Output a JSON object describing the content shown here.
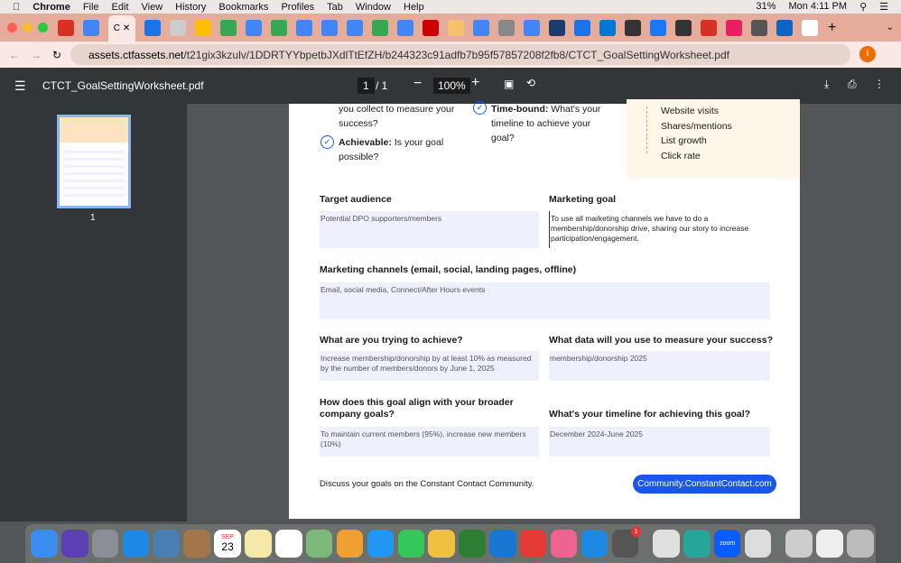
{
  "menubar": {
    "app": "Chrome",
    "items": [
      "File",
      "Edit",
      "View",
      "History",
      "Bookmarks",
      "Profiles",
      "Tab",
      "Window",
      "Help"
    ],
    "battery": "31%",
    "clock": "Mon 4:11 PM"
  },
  "tabs": {
    "active_label": "C",
    "colors": [
      "#d93025",
      "#4285f4",
      "#1a73e8",
      "#cccccc",
      "#fbbc04",
      "#34a853",
      "#4285f4",
      "#34a853",
      "#4285f4",
      "#4285f4",
      "#4285f4",
      "#34a853",
      "#4285f4",
      "#cc0000",
      "#f5c16c",
      "#4285f4",
      "#888888",
      "#4285f4",
      "#1d3c6e",
      "#1a73e8",
      "#0078d4",
      "#333333",
      "#1877f2",
      "#333333",
      "#d93025",
      "#e91e63",
      "#555555",
      "#0a66c2",
      "#ffffff"
    ]
  },
  "address": {
    "host": "assets.ctfassets.net",
    "path": "/t21gix3kzulv/1DDRTYYbpetbJXdlTtEfZH/b244323c91adfb7b95f57857208f2fb8/CTCT_GoalSettingWorksheet.pdf",
    "avatar": "I"
  },
  "pdf": {
    "title": "CTCT_GoalSettingWorksheet.pdf",
    "page_current": "1",
    "page_total": "/ 1",
    "zoom": "100%",
    "thumb_page": "1"
  },
  "doc": {
    "smart": [
      {
        "text": "you collect to measure your success?"
      },
      {
        "bold": "Achievable:",
        "text": " Is your goal possible?"
      },
      {
        "bold": "Time-bound:",
        "text": " What's your timeline to achieve your goal?"
      }
    ],
    "metrics": [
      "Website visits",
      "Shares/mentions",
      "List growth",
      "Click rate"
    ],
    "fields": [
      {
        "label": "Target audience",
        "value": "Potential DPO supporters/members"
      },
      {
        "label": "Marketing goal",
        "value": "To use all marketing channels we have to do a membership/donorship drive, sharing our story to increase participation/engagement."
      },
      {
        "label": "Marketing channels (email, social, landing pages, offline)",
        "value": "Email, social media, Connect/After Hours events"
      },
      {
        "label": "What are you trying to achieve?",
        "value": "Increase membership/donorship by at least 10% as measured by the number of members/donors by June 1, 2025"
      },
      {
        "label": "What data will you use to measure your success?",
        "value": "membership/donorship 2025"
      },
      {
        "label": "How does this goal align with your broader company goals?",
        "value": "To maintain current members (95%), increase new members (10%)"
      },
      {
        "label": "What's your timeline for achieving this goal?",
        "value": "December 2024-June 2025"
      }
    ],
    "footer_text": "Discuss your goals on the Constant Contact Community.",
    "footer_button": "Community.ConstantContact.com",
    "accent": "#1856ed"
  },
  "dock": {
    "calendar_month": "SEP",
    "calendar_day": "23",
    "badge": "1",
    "zoom_label": "zoom",
    "colors": [
      "#3b8df0",
      "#5a3fb5",
      "#8a8f96",
      "#1e88e5",
      "#4a7fb5",
      "#a3764a",
      "#ffffff",
      "#f4e9a8",
      "#ffffff",
      "#7cb87a",
      "#f0a030",
      "#2196f3",
      "#34c759",
      "#f0c040",
      "#2e7d32",
      "#1976d2",
      "#e53935",
      "#f06292",
      "#1e88e5",
      "#555555",
      "#e0e0e0",
      "#26a69a",
      "#0b5cff",
      "#dddddd",
      "#cccccc",
      "#eeeeee",
      "#bbbbbb"
    ]
  }
}
